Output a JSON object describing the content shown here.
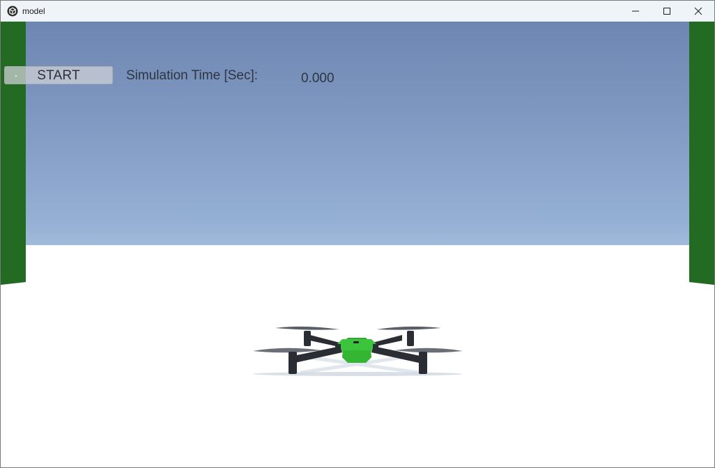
{
  "window": {
    "title": "model",
    "icon": "unity-app-icon",
    "controls": [
      "minimize-icon",
      "maximize-icon",
      "close-icon"
    ]
  },
  "hud": {
    "start_label": "START",
    "sim_time_label": "Simulation Time [Sec]:",
    "sim_time_value": "0.000"
  },
  "scene": {
    "object": "quadcopter-drone",
    "colors": {
      "sky_top": "#6e87b2",
      "sky_horizon": "#e8f6f8",
      "ground": "#ffffff",
      "walls": "#236b23",
      "drone_body": "#3cc43c",
      "drone_frame": "#2a2d33"
    }
  }
}
